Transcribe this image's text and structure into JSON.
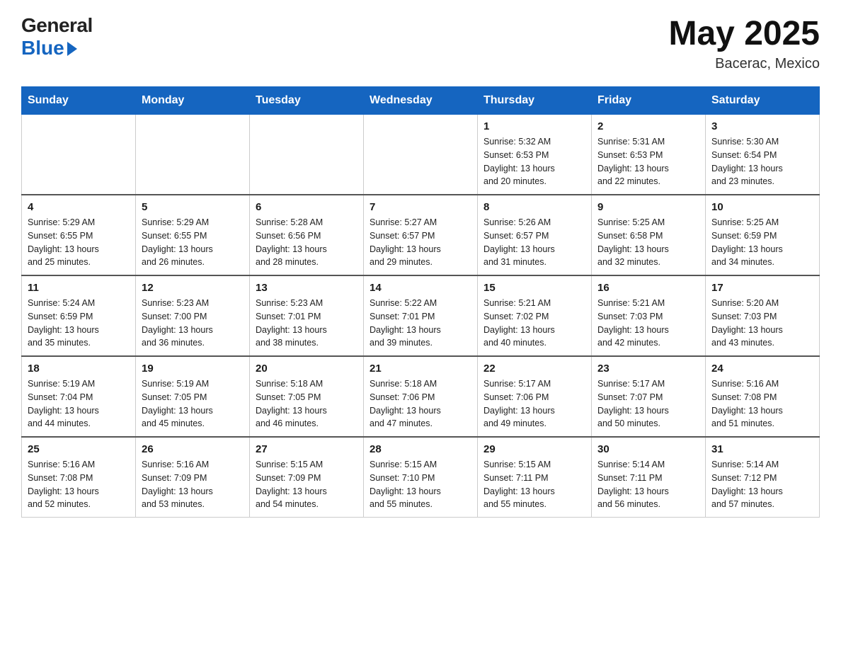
{
  "header": {
    "logo_general": "General",
    "logo_blue": "Blue",
    "month_year": "May 2025",
    "location": "Bacerac, Mexico"
  },
  "weekdays": [
    "Sunday",
    "Monday",
    "Tuesday",
    "Wednesday",
    "Thursday",
    "Friday",
    "Saturday"
  ],
  "weeks": [
    [
      {
        "day": "",
        "info": ""
      },
      {
        "day": "",
        "info": ""
      },
      {
        "day": "",
        "info": ""
      },
      {
        "day": "",
        "info": ""
      },
      {
        "day": "1",
        "info": "Sunrise: 5:32 AM\nSunset: 6:53 PM\nDaylight: 13 hours\nand 20 minutes."
      },
      {
        "day": "2",
        "info": "Sunrise: 5:31 AM\nSunset: 6:53 PM\nDaylight: 13 hours\nand 22 minutes."
      },
      {
        "day": "3",
        "info": "Sunrise: 5:30 AM\nSunset: 6:54 PM\nDaylight: 13 hours\nand 23 minutes."
      }
    ],
    [
      {
        "day": "4",
        "info": "Sunrise: 5:29 AM\nSunset: 6:55 PM\nDaylight: 13 hours\nand 25 minutes."
      },
      {
        "day": "5",
        "info": "Sunrise: 5:29 AM\nSunset: 6:55 PM\nDaylight: 13 hours\nand 26 minutes."
      },
      {
        "day": "6",
        "info": "Sunrise: 5:28 AM\nSunset: 6:56 PM\nDaylight: 13 hours\nand 28 minutes."
      },
      {
        "day": "7",
        "info": "Sunrise: 5:27 AM\nSunset: 6:57 PM\nDaylight: 13 hours\nand 29 minutes."
      },
      {
        "day": "8",
        "info": "Sunrise: 5:26 AM\nSunset: 6:57 PM\nDaylight: 13 hours\nand 31 minutes."
      },
      {
        "day": "9",
        "info": "Sunrise: 5:25 AM\nSunset: 6:58 PM\nDaylight: 13 hours\nand 32 minutes."
      },
      {
        "day": "10",
        "info": "Sunrise: 5:25 AM\nSunset: 6:59 PM\nDaylight: 13 hours\nand 34 minutes."
      }
    ],
    [
      {
        "day": "11",
        "info": "Sunrise: 5:24 AM\nSunset: 6:59 PM\nDaylight: 13 hours\nand 35 minutes."
      },
      {
        "day": "12",
        "info": "Sunrise: 5:23 AM\nSunset: 7:00 PM\nDaylight: 13 hours\nand 36 minutes."
      },
      {
        "day": "13",
        "info": "Sunrise: 5:23 AM\nSunset: 7:01 PM\nDaylight: 13 hours\nand 38 minutes."
      },
      {
        "day": "14",
        "info": "Sunrise: 5:22 AM\nSunset: 7:01 PM\nDaylight: 13 hours\nand 39 minutes."
      },
      {
        "day": "15",
        "info": "Sunrise: 5:21 AM\nSunset: 7:02 PM\nDaylight: 13 hours\nand 40 minutes."
      },
      {
        "day": "16",
        "info": "Sunrise: 5:21 AM\nSunset: 7:03 PM\nDaylight: 13 hours\nand 42 minutes."
      },
      {
        "day": "17",
        "info": "Sunrise: 5:20 AM\nSunset: 7:03 PM\nDaylight: 13 hours\nand 43 minutes."
      }
    ],
    [
      {
        "day": "18",
        "info": "Sunrise: 5:19 AM\nSunset: 7:04 PM\nDaylight: 13 hours\nand 44 minutes."
      },
      {
        "day": "19",
        "info": "Sunrise: 5:19 AM\nSunset: 7:05 PM\nDaylight: 13 hours\nand 45 minutes."
      },
      {
        "day": "20",
        "info": "Sunrise: 5:18 AM\nSunset: 7:05 PM\nDaylight: 13 hours\nand 46 minutes."
      },
      {
        "day": "21",
        "info": "Sunrise: 5:18 AM\nSunset: 7:06 PM\nDaylight: 13 hours\nand 47 minutes."
      },
      {
        "day": "22",
        "info": "Sunrise: 5:17 AM\nSunset: 7:06 PM\nDaylight: 13 hours\nand 49 minutes."
      },
      {
        "day": "23",
        "info": "Sunrise: 5:17 AM\nSunset: 7:07 PM\nDaylight: 13 hours\nand 50 minutes."
      },
      {
        "day": "24",
        "info": "Sunrise: 5:16 AM\nSunset: 7:08 PM\nDaylight: 13 hours\nand 51 minutes."
      }
    ],
    [
      {
        "day": "25",
        "info": "Sunrise: 5:16 AM\nSunset: 7:08 PM\nDaylight: 13 hours\nand 52 minutes."
      },
      {
        "day": "26",
        "info": "Sunrise: 5:16 AM\nSunset: 7:09 PM\nDaylight: 13 hours\nand 53 minutes."
      },
      {
        "day": "27",
        "info": "Sunrise: 5:15 AM\nSunset: 7:09 PM\nDaylight: 13 hours\nand 54 minutes."
      },
      {
        "day": "28",
        "info": "Sunrise: 5:15 AM\nSunset: 7:10 PM\nDaylight: 13 hours\nand 55 minutes."
      },
      {
        "day": "29",
        "info": "Sunrise: 5:15 AM\nSunset: 7:11 PM\nDaylight: 13 hours\nand 55 minutes."
      },
      {
        "day": "30",
        "info": "Sunrise: 5:14 AM\nSunset: 7:11 PM\nDaylight: 13 hours\nand 56 minutes."
      },
      {
        "day": "31",
        "info": "Sunrise: 5:14 AM\nSunset: 7:12 PM\nDaylight: 13 hours\nand 57 minutes."
      }
    ]
  ]
}
